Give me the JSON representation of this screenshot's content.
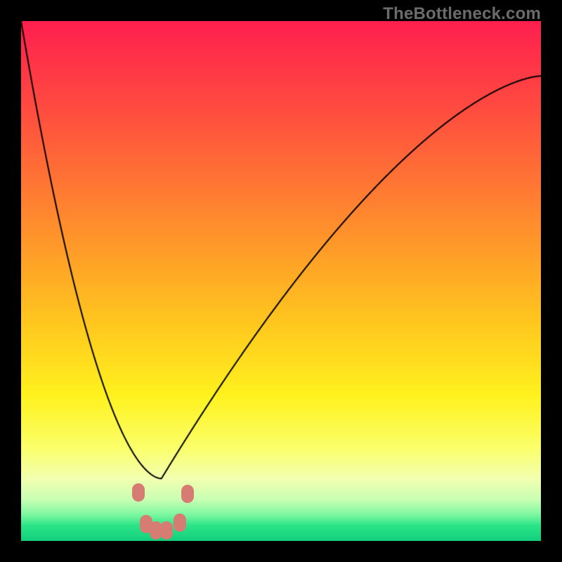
{
  "chart_data": {
    "type": "line",
    "title": "",
    "watermark": "TheBottleneck.com",
    "xlabel": "",
    "ylabel": "",
    "xlim": [
      0,
      100
    ],
    "ylim": [
      0,
      100
    ],
    "gradient_stops": [
      {
        "pct": 0,
        "color": "#ff1f4f"
      },
      {
        "pct": 18,
        "color": "#ff4f3f"
      },
      {
        "pct": 38,
        "color": "#ff8a2e"
      },
      {
        "pct": 58,
        "color": "#ffc71e"
      },
      {
        "pct": 72,
        "color": "#fff21e"
      },
      {
        "pct": 82,
        "color": "#fbff69"
      },
      {
        "pct": 88,
        "color": "#f3ffb0"
      },
      {
        "pct": 92,
        "color": "#c9ffb4"
      },
      {
        "pct": 95,
        "color": "#7cf7a0"
      },
      {
        "pct": 97,
        "color": "#2de588"
      },
      {
        "pct": 100,
        "color": "#12cf7c"
      }
    ],
    "series": [
      {
        "name": "bottleneck-curve",
        "x": [
          0,
          2,
          5,
          8,
          11,
          14,
          17,
          19,
          21,
          23,
          24,
          25,
          26,
          27,
          29,
          31,
          33,
          36,
          40,
          45,
          50,
          56,
          62,
          70,
          78,
          86,
          94,
          100
        ],
        "y": [
          100,
          90,
          80,
          70,
          60,
          50,
          40,
          32,
          24,
          16,
          10,
          5,
          2,
          0,
          0,
          2,
          6,
          12,
          20,
          30,
          40,
          50,
          58,
          66,
          73,
          79,
          84,
          88
        ]
      }
    ],
    "markers": [
      {
        "x": 22.5,
        "y": 9.3
      },
      {
        "x": 24.0,
        "y": 3.2
      },
      {
        "x": 26.0,
        "y": 2.0
      },
      {
        "x": 28.0,
        "y": 2.0
      },
      {
        "x": 30.5,
        "y": 3.5
      },
      {
        "x": 32.0,
        "y": 9.0
      }
    ],
    "marker_color": "#d77c73",
    "curve_color": "#000000",
    "green_limit_pct": 12,
    "minimum_x_pct": 27
  },
  "watermark": {
    "text": "TheBottleneck.com"
  }
}
